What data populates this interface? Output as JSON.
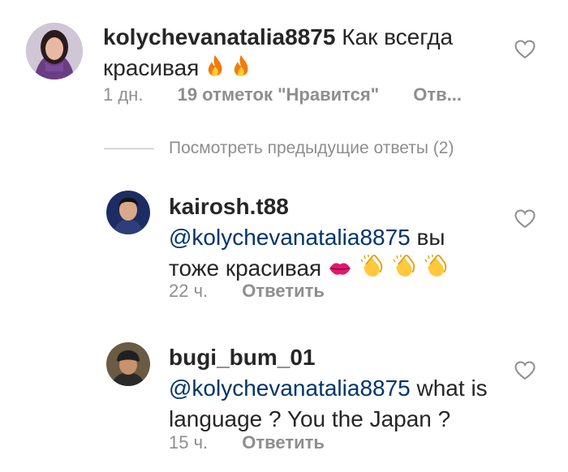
{
  "comments": [
    {
      "username": "kolychevanatalia8875",
      "text": "Как всегда красивая",
      "emoji": [
        "fire",
        "fire"
      ],
      "time": "1 дн.",
      "likes": "19 отметок \"Нравится\"",
      "reply_label": "Отв..."
    }
  ],
  "view_replies": "Посмотреть предыдущие ответы (2)",
  "replies": [
    {
      "username": "kairosh.t88",
      "mention": "@kolychevanatalia8875",
      "text_after_mention": " вы",
      "text_line2": "тоже красивая",
      "emoji": [
        "kiss",
        "clap",
        "clap",
        "clap"
      ],
      "time": "22 ч.",
      "reply_label": "Ответить"
    },
    {
      "username": "bugi_bum_01",
      "mention": "@kolychevanatalia8875",
      "text_after_mention": " what is",
      "text_line2": "language ? You the Japan ?",
      "time": "15 ч.",
      "reply_label": "Ответить"
    }
  ],
  "icons": {
    "like": "heart-outline-icon",
    "fire": "fire-emoji",
    "kiss": "kiss-lips-emoji",
    "clap": "clapping-hands-emoji"
  },
  "colors": {
    "mention": "#003569",
    "meta": "#8e8e8e",
    "text": "#262626"
  }
}
